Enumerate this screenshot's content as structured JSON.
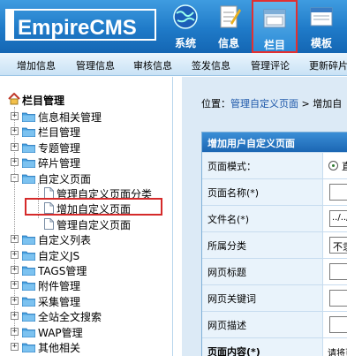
{
  "header": {
    "logo_text": "EmpireCMS",
    "nav": [
      {
        "label": "系统",
        "icon": "globe-icon"
      },
      {
        "label": "信息",
        "icon": "notepad-icon"
      },
      {
        "label": "栏目",
        "icon": "folder-window-icon",
        "active": true
      },
      {
        "label": "模板",
        "icon": "window-icon"
      }
    ]
  },
  "subnav": {
    "items": [
      "增加信息",
      "管理信息",
      "审核信息",
      "签发信息",
      "管理评论",
      "更新碎片"
    ]
  },
  "sidebar": {
    "title": "栏目管理",
    "items": [
      {
        "label": "信息相关管理",
        "expanded": false
      },
      {
        "label": "栏目管理",
        "expanded": false
      },
      {
        "label": "专题管理",
        "expanded": false
      },
      {
        "label": "碎片管理",
        "expanded": false
      },
      {
        "label": "自定义页面",
        "expanded": true,
        "children": [
          "管理自定义页面分类",
          "增加自定义页面",
          "管理自定义页面"
        ]
      },
      {
        "label": "自定义列表",
        "expanded": false
      },
      {
        "label": "自定义JS",
        "expanded": false
      },
      {
        "label": "TAGS管理",
        "expanded": false
      },
      {
        "label": "附件管理",
        "expanded": false
      },
      {
        "label": "采集管理",
        "expanded": false
      },
      {
        "label": "全站全文搜索",
        "expanded": false
      },
      {
        "label": "WAP管理",
        "expanded": false
      },
      {
        "label": "其他相关",
        "expanded": false
      }
    ],
    "highlighted_child": "增加自定义页面"
  },
  "main": {
    "breadcrumb": {
      "prefix": "位置：",
      "link": "管理自定义页面",
      "sep": " > ",
      "current": "增加自"
    },
    "form": {
      "header": "增加用户自定义页面",
      "rows": [
        {
          "label": "页面模式：",
          "type": "radio",
          "value": "直"
        },
        {
          "label": "页面名称(*)",
          "type": "input",
          "value": ""
        },
        {
          "label": "文件名(*)",
          "type": "input",
          "value": "../../"
        },
        {
          "label": "所属分类",
          "type": "select",
          "value": "不隶"
        },
        {
          "label": "网页标题",
          "type": "input",
          "value": ""
        },
        {
          "label": "网页关键词",
          "type": "input",
          "value": ""
        },
        {
          "label": "网页描述",
          "type": "input",
          "value": ""
        },
        {
          "label": "页面内容(*)",
          "type": "hint",
          "value": "请将页"
        }
      ]
    }
  },
  "colors": {
    "header_blue": "#1f7ac8",
    "highlight_red": "#d52a2a",
    "link_blue": "#1a55a8",
    "form_header_blue": "#1b66b3"
  }
}
